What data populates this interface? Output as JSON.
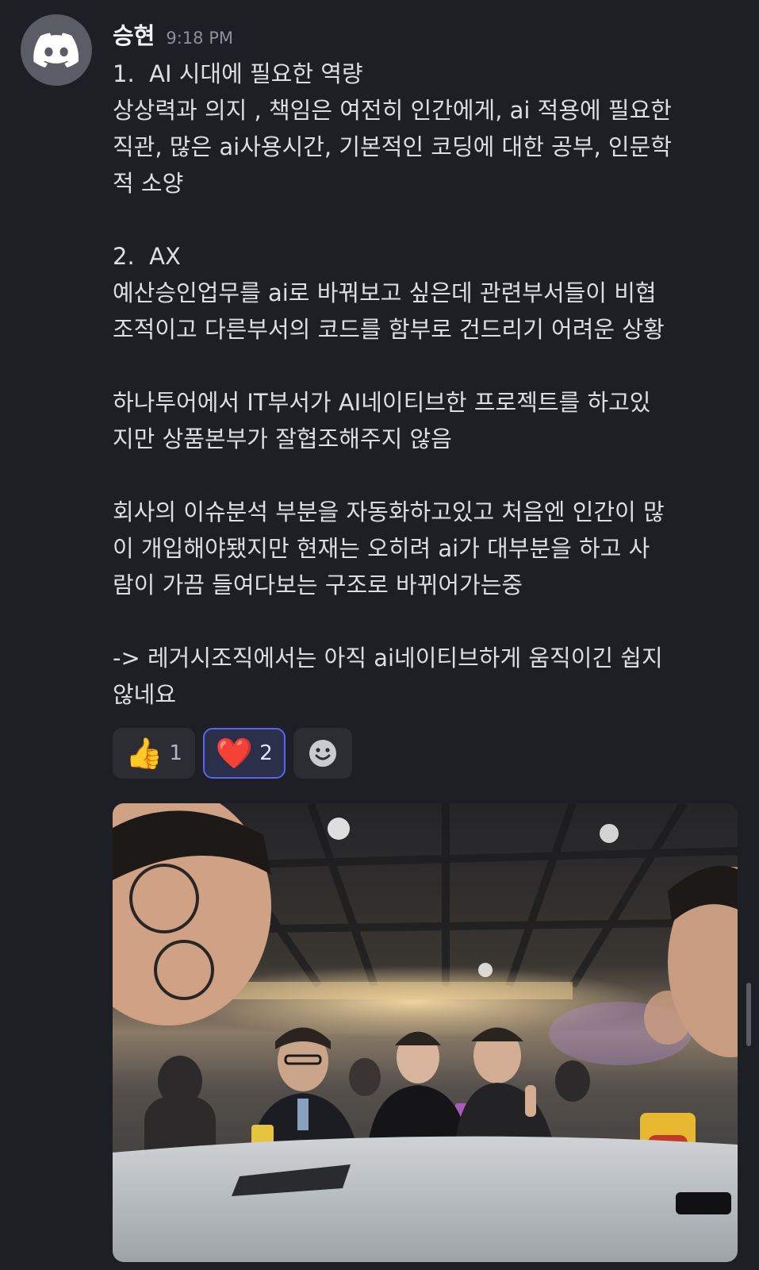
{
  "message": {
    "username": "승현",
    "timestamp": "9:18 PM",
    "lines": [
      "1.  AI 시대에 필요한 역량",
      "상상력과 의지 , 책임은 여전히 인간에게, ai 적용에 필요한",
      "직관, 많은 ai사용시간, 기본적인 코딩에 대한 공부, 인문학",
      "적 소양",
      "",
      "2.  AX",
      "예산승인업무를 ai로 바꿔보고 싶은데 관련부서들이 비협",
      "조적이고 다른부서의 코드를 함부로 건드리기 어려운 상황",
      "",
      "하나투어에서 IT부서가 AI네이티브한 프로젝트를 하고있",
      "지만 상품본부가 잘협조해주지 않음",
      "",
      "회사의 이슈분석 부분을 자동화하고있고 처음엔 인간이 많",
      "이 개입해야됐지만 현재는 오히려 ai가 대부분을 하고 사",
      "람이 가끔 들여다보는 구조로 바뀌어가는중",
      "",
      "-> 레거시조직에서는 아직 ai네이티브하게 움직이긴 쉽지",
      "않네요"
    ]
  },
  "reactions": [
    {
      "emoji": "👍",
      "count": "1",
      "active": false
    },
    {
      "emoji": "❤️",
      "count": "2",
      "active": true
    }
  ],
  "icons": {
    "avatar": "discord-logo-icon",
    "add_reaction": "smiley-add-reaction-icon"
  },
  "colors": {
    "background": "#1e1f24",
    "accent": "#5865f2",
    "text": "#dcdee3"
  }
}
